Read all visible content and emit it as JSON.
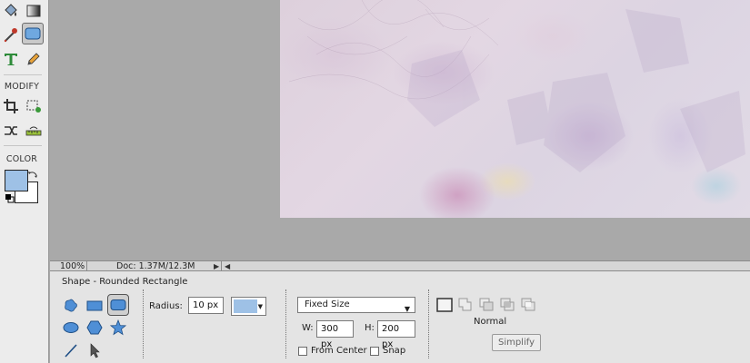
{
  "toolbox": {
    "modify_label": "MODIFY",
    "color_label": "COLOR",
    "foreground_color": "#9ec1e6",
    "background_color": "#ffffff",
    "tools": [
      {
        "name": "paint-bucket-tool",
        "icon": "paint-bucket-icon"
      },
      {
        "name": "gradient-tool",
        "icon": "gradient-icon"
      },
      {
        "name": "eyedropper-tool",
        "icon": "eyedropper-icon"
      },
      {
        "name": "shape-tool",
        "icon": "rounded-rectangle-icon",
        "active": true
      },
      {
        "name": "type-tool",
        "icon": "type-icon"
      },
      {
        "name": "pencil-tool",
        "icon": "pencil-icon"
      },
      {
        "name": "crop-tool",
        "icon": "crop-icon"
      },
      {
        "name": "recompose-tool",
        "icon": "recompose-icon"
      },
      {
        "name": "content-aware-move-tool",
        "icon": "content-aware-move-icon"
      },
      {
        "name": "straighten-tool",
        "icon": "straighten-icon"
      }
    ]
  },
  "statusbar": {
    "zoom": "100%",
    "doc_info": "Doc: 1.37M/12.3M"
  },
  "options": {
    "title": "Shape - Rounded Rectangle",
    "radius_label": "Radius:",
    "radius_value": "10 px",
    "shape_color": "#9ec1e6",
    "size_mode": "Fixed Size",
    "width_label": "W:",
    "width_value": "300 px",
    "height_label": "H:",
    "height_value": "200 px",
    "from_center_label": "From Center",
    "snap_label": "Snap",
    "mode_label": "Normal",
    "simplify_label": "Simplify",
    "shapes": [
      "custom-shape",
      "rectangle",
      "rounded-rectangle",
      "ellipse",
      "polygon",
      "star",
      "line",
      "shape-selection"
    ],
    "selected_shape": "rounded-rectangle"
  }
}
